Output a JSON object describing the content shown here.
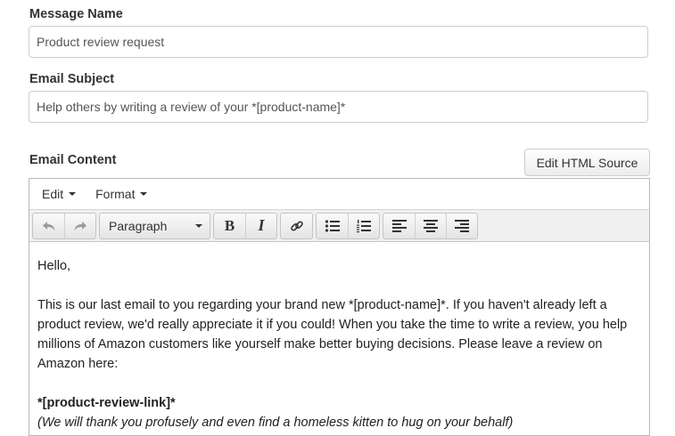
{
  "form": {
    "message_name_label": "Message Name",
    "message_name_value": "Product review request",
    "email_subject_label": "Email Subject",
    "email_subject_value": "Help others by writing a review of your *[product-name]*",
    "email_content_label": "Email Content",
    "edit_html_button": "Edit HTML Source"
  },
  "editor": {
    "menu": [
      {
        "label": "Edit"
      },
      {
        "label": "Format"
      }
    ],
    "toolbar": {
      "block_format": "Paragraph",
      "icons": [
        "undo-icon",
        "redo-icon",
        "bold-icon",
        "italic-icon",
        "link-icon",
        "bullet-list-icon",
        "numbered-list-icon",
        "align-left-icon",
        "align-center-icon",
        "align-right-icon"
      ],
      "bold_glyph": "B",
      "italic_glyph": "I"
    },
    "content": {
      "greeting": "Hello,",
      "body": "This is our last email to you regarding your brand new *[product-name]*. If you haven't already left a product review, we'd really appreciate it if you could! When you take the time to write a review, you help millions of Amazon customers like yourself make better buying decisions. Please leave a review on Amazon here:",
      "link_tag": "*[product-review-link]*",
      "note": "(We will thank you profusely and even find a homeless kitten to hug on your behalf)"
    }
  }
}
